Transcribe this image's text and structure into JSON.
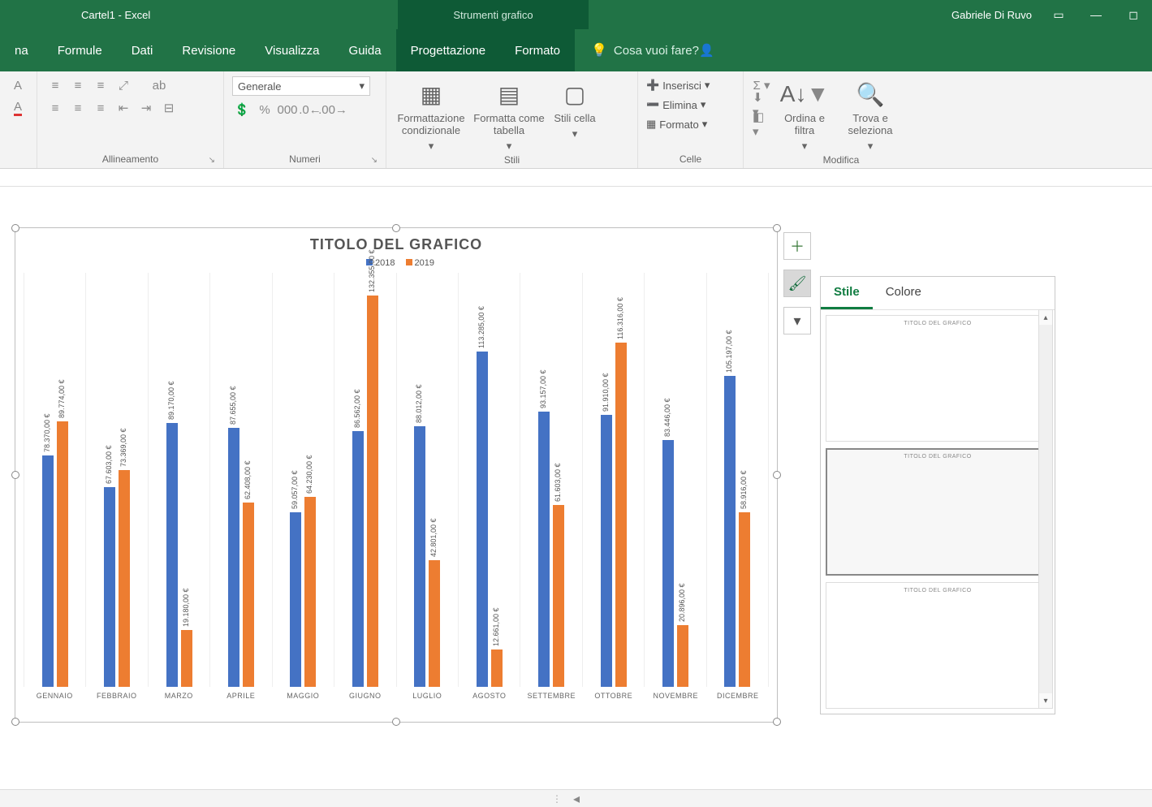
{
  "titlebar": {
    "doc": "Cartel1  -  Excel",
    "contextual_tab": "Strumenti grafico",
    "user": "Gabriele Di Ruvo"
  },
  "tabs": [
    "na",
    "Formule",
    "Dati",
    "Revisione",
    "Visualizza",
    "Guida",
    "Progettazione",
    "Formato"
  ],
  "tellme_placeholder": "Cosa vuoi fare?",
  "ribbon": {
    "alignment_label": "Allineamento",
    "number_label": "Numeri",
    "number_format": "Generale",
    "styles_label": "Stili",
    "styles": {
      "cond": "Formattazione condizionale",
      "tbl": "Formatta come tabella",
      "cell": "Stili cella"
    },
    "cells_label": "Celle",
    "cells": {
      "insert": "Inserisci",
      "delete": "Elimina",
      "format": "Formato"
    },
    "editing_label": "Modifica",
    "editing": {
      "sort": "Ordina e filtra",
      "find": "Trova e seleziona"
    }
  },
  "chart": {
    "title": "TITOLO DEL GRAFICO",
    "legend": [
      "2018",
      "2019"
    ]
  },
  "stylepane": {
    "tab_style": "Stile",
    "tab_color": "Colore",
    "preview_title": "TITOLO DEL GRAFICO"
  },
  "chart_data": {
    "type": "bar",
    "categories": [
      "GENNAIO",
      "FEBBRAIO",
      "MARZO",
      "APRILE",
      "MAGGIO",
      "GIUGNO",
      "LUGLIO",
      "AGOSTO",
      "SETTEMBRE",
      "OTTOBRE",
      "NOVEMBRE",
      "DICEMBRE"
    ],
    "series": [
      {
        "name": "2018",
        "color": "#4472C4",
        "values": [
          78370,
          67603,
          89170,
          87655,
          59057,
          86562,
          88012,
          113285,
          93157,
          91910,
          83446,
          105197
        ]
      },
      {
        "name": "2019",
        "color": "#ED7D31",
        "values": [
          89774,
          73369,
          19180,
          62408,
          64230,
          132355,
          42801,
          12661,
          61603,
          116316,
          20896,
          58916
        ]
      }
    ],
    "data_label_suffix": ",00 €",
    "ylim": [
      0,
      140000
    ],
    "title": "TITOLO DEL GRAFICO"
  }
}
